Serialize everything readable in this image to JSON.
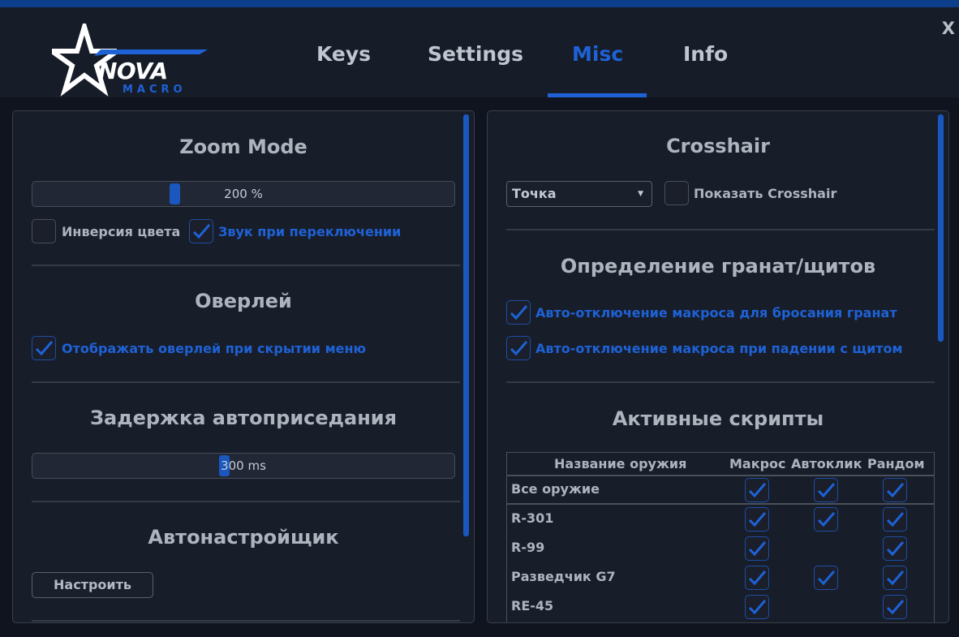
{
  "window": {
    "close_label": "X"
  },
  "logo": {
    "word": "NOVA",
    "sub": "MACRO"
  },
  "tabs": [
    {
      "label": "Keys",
      "active": false
    },
    {
      "label": "Settings",
      "active": false
    },
    {
      "label": "Misc",
      "active": true
    },
    {
      "label": "Info",
      "active": false
    }
  ],
  "colors": {
    "accent": "#1e62d6",
    "panel_bg": "#181d2a",
    "app_bg": "#0f141e",
    "header_bg": "#171c29"
  },
  "left": {
    "zoom": {
      "title": "Zoom Mode",
      "slider_value": "200 %",
      "slider_fraction": 0.32,
      "invert_label": "Инверсия цвета",
      "invert_checked": false,
      "sound_label": "Звук при переключении",
      "sound_checked": true
    },
    "overlay": {
      "title": "Оверлей",
      "show_label": "Отображать оверлей при скрытии меню",
      "show_checked": true
    },
    "crouch": {
      "title": "Задержка автоприседания",
      "slider_value": "300 ms",
      "slider_fraction": 0.45
    },
    "autotune": {
      "title": "Автонастройщик",
      "button_label": "Настроить"
    }
  },
  "right": {
    "crosshair": {
      "title": "Crosshair",
      "select_value": "Точка",
      "show_label": "Показать Crosshair",
      "show_checked": false
    },
    "grenades": {
      "title": "Определение гранат/щитов",
      "grenade_label": "Авто-отключение макроса для бросания гранат",
      "grenade_checked": true,
      "shield_label": "Авто-отключение макроса при падении с щитом",
      "shield_checked": true
    },
    "scripts": {
      "title": "Активные скрипты",
      "columns": [
        "Название оружия",
        "Макрос",
        "Автоклик",
        "Рандом"
      ],
      "rows": [
        {
          "name": "Все оружие",
          "macro": true,
          "autoclick": true,
          "random": true
        },
        {
          "name": "R-301",
          "macro": true,
          "autoclick": true,
          "random": true
        },
        {
          "name": "R-99",
          "macro": true,
          "autoclick": false,
          "random": true
        },
        {
          "name": "Разведчик G7",
          "macro": true,
          "autoclick": true,
          "random": true
        },
        {
          "name": "RE-45",
          "macro": true,
          "autoclick": false,
          "random": true
        }
      ]
    }
  }
}
